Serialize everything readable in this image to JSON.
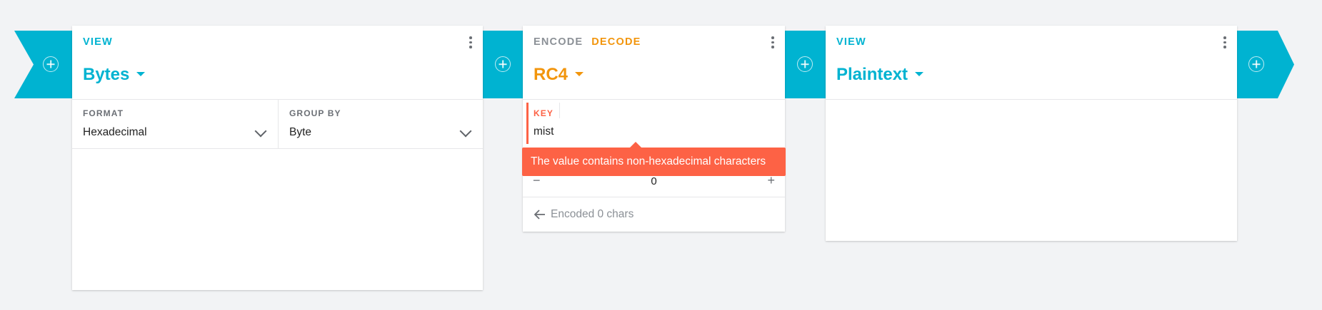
{
  "colors": {
    "accent": "#00b3d1",
    "accent_orange": "#f2950c",
    "error": "#fd6245"
  },
  "pipeline": {
    "add_icon": "plus-circle-icon"
  },
  "bytes_card": {
    "tab": "VIEW",
    "title": "Bytes",
    "format_label": "FORMAT",
    "format_value": "Hexadecimal",
    "group_label": "GROUP BY",
    "group_value": "Byte"
  },
  "rc4_card": {
    "tab_encode": "ENCODE",
    "tab_decode": "DECODE",
    "title": "RC4",
    "key_label": "KEY",
    "key_value": "mist",
    "drop_value": "0",
    "minus": "−",
    "plus": "+",
    "error_message": "The value contains non-hexadecimal characters",
    "status": "Encoded 0 chars"
  },
  "plaintext_card": {
    "tab": "VIEW",
    "title": "Plaintext"
  }
}
